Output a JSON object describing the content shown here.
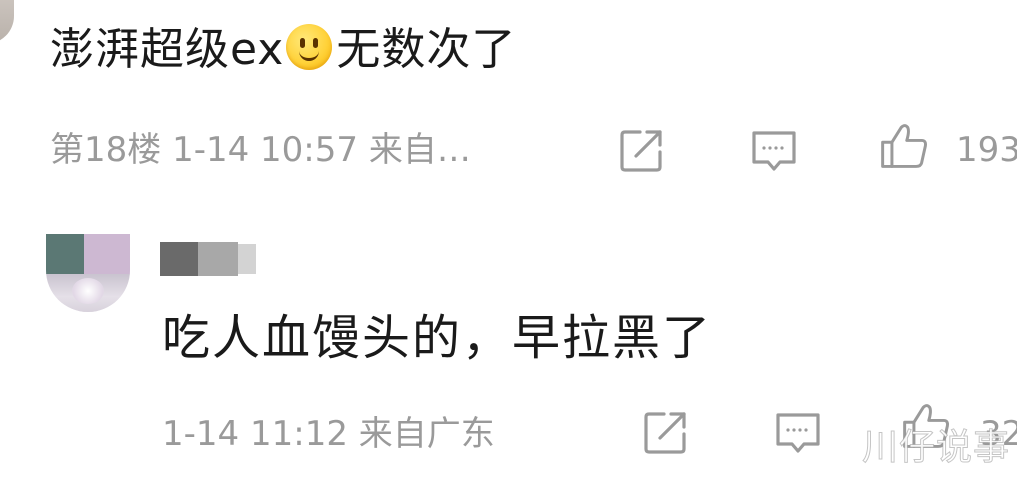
{
  "comments": [
    {
      "text_before_emoji": "澎湃超级ex",
      "emoji": "smile-emoji",
      "text_after_emoji": "无数次了",
      "meta": "第18楼 1-14 10:57 来自…",
      "like_count": "193"
    },
    {
      "username_visible_tail": "",
      "text": "吃人血馒头的，早拉黑了",
      "meta": "1-14 11:12 来自广东",
      "like_count": "32"
    }
  ],
  "icons": {
    "share": "share-icon",
    "reply": "comment-icon",
    "like": "thumbs-up-icon"
  },
  "watermark": "川仔说事",
  "colors": {
    "text": "#1a1a1a",
    "meta": "#9a9a9a",
    "icon": "#9a9a9a",
    "emoji": "#ffd23a"
  }
}
